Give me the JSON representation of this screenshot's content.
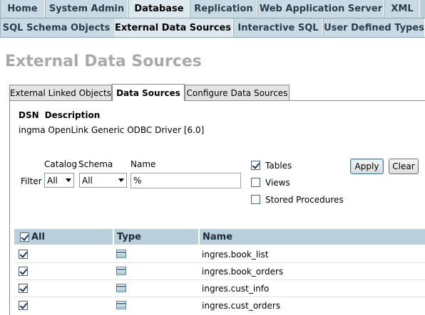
{
  "nav_primary": [
    {
      "label": "Home",
      "active": false
    },
    {
      "label": "System Admin",
      "active": false
    },
    {
      "label": "Database",
      "active": true
    },
    {
      "label": "Replication",
      "active": false
    },
    {
      "label": "Web Application Server",
      "active": false
    },
    {
      "label": "XML",
      "active": false
    }
  ],
  "nav_secondary": [
    {
      "label": "SQL Schema Objects",
      "active": false
    },
    {
      "label": "External Data Sources",
      "active": true
    },
    {
      "label": "Interactive SQL",
      "active": false
    },
    {
      "label": "User Defined Types",
      "active": false
    }
  ],
  "page_title": "External Data Sources",
  "sub_tabs": [
    {
      "label": "External Linked Objects",
      "active": false
    },
    {
      "label": "Data Sources",
      "active": true
    },
    {
      "label": "Configure Data Sources",
      "active": false
    }
  ],
  "dsn": {
    "col_dsn": "DSN",
    "col_description": "Description",
    "value": "ingma OpenLink Generic ODBC Driver [6.0]"
  },
  "filter": {
    "label": "Filter",
    "catalog_label": "Catalog",
    "schema_label": "Schema",
    "name_label": "Name",
    "catalog_value": "All",
    "schema_value": "All",
    "name_value": "%"
  },
  "object_types": [
    {
      "label": "Tables",
      "checked": true
    },
    {
      "label": "Views",
      "checked": false
    },
    {
      "label": "Stored Procedures",
      "checked": false
    }
  ],
  "buttons": {
    "apply": "Apply",
    "clear": "Clear"
  },
  "table": {
    "headers": {
      "all": "All",
      "type": "Type",
      "name": "Name"
    },
    "all_checked": true,
    "rows": [
      {
        "checked": true,
        "type_icon": "table-icon",
        "name": "ingres.book_list"
      },
      {
        "checked": true,
        "type_icon": "table-icon",
        "name": "ingres.book_orders"
      },
      {
        "checked": true,
        "type_icon": "table-icon",
        "name": "ingres.cust_info"
      },
      {
        "checked": true,
        "type_icon": "table-icon",
        "name": "ingres.cust_orders"
      }
    ]
  },
  "colors": {
    "nav_background": "#b9cfda",
    "title_gray": "#a9a9a9"
  }
}
